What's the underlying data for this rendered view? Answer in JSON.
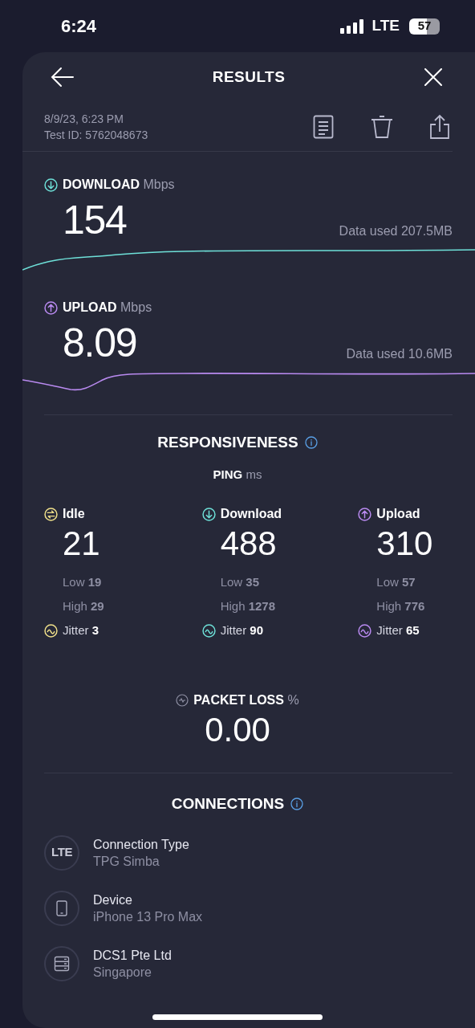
{
  "status_bar": {
    "time": "6:24",
    "network": "LTE",
    "battery": "57"
  },
  "header": {
    "title": "RESULTS"
  },
  "test": {
    "date": "8/9/23, 6:23 PM",
    "test_id": "Test ID: 5762048673"
  },
  "speed": [
    {
      "kind": "download",
      "label": "DOWNLOAD",
      "unit": "Mbps",
      "value": "154",
      "data_used": "Data used 207.5MB",
      "color": "#6ee0d8"
    },
    {
      "kind": "upload",
      "label": "UPLOAD",
      "unit": "Mbps",
      "value": "8.09",
      "data_used": "Data used 10.6MB",
      "color": "#b98af0"
    }
  ],
  "responsiveness": {
    "title": "RESPONSIVENESS",
    "ping_label": "PING",
    "ping_unit": "ms",
    "columns": [
      {
        "kind": "idle",
        "label": "Idle",
        "value": "21",
        "low_label": "Low",
        "low": "19",
        "high_label": "High",
        "high": "29",
        "jitter_label": "Jitter",
        "jitter": "3",
        "color": "#f0e08a"
      },
      {
        "kind": "download",
        "label": "Download",
        "value": "488",
        "low_label": "Low",
        "low": "35",
        "high_label": "High",
        "high": "1278",
        "jitter_label": "Jitter",
        "jitter": "90",
        "color": "#6ee0d8"
      },
      {
        "kind": "upload",
        "label": "Upload",
        "value": "310",
        "low_label": "Low",
        "low": "57",
        "high_label": "High",
        "high": "776",
        "jitter_label": "Jitter",
        "jitter": "65",
        "color": "#b98af0"
      }
    ]
  },
  "packet_loss": {
    "label": "PACKET LOSS",
    "unit": "%",
    "value": "0.00"
  },
  "connections": {
    "title": "CONNECTIONS",
    "items": [
      {
        "kind": "network",
        "icon_text": "LTE",
        "title": "Connection Type",
        "subtitle": "TPG Simba"
      },
      {
        "kind": "device",
        "title": "Device",
        "subtitle": "iPhone 13 Pro Max"
      },
      {
        "kind": "server",
        "title": "DCS1 Pte Ltd",
        "subtitle": "Singapore"
      }
    ]
  }
}
